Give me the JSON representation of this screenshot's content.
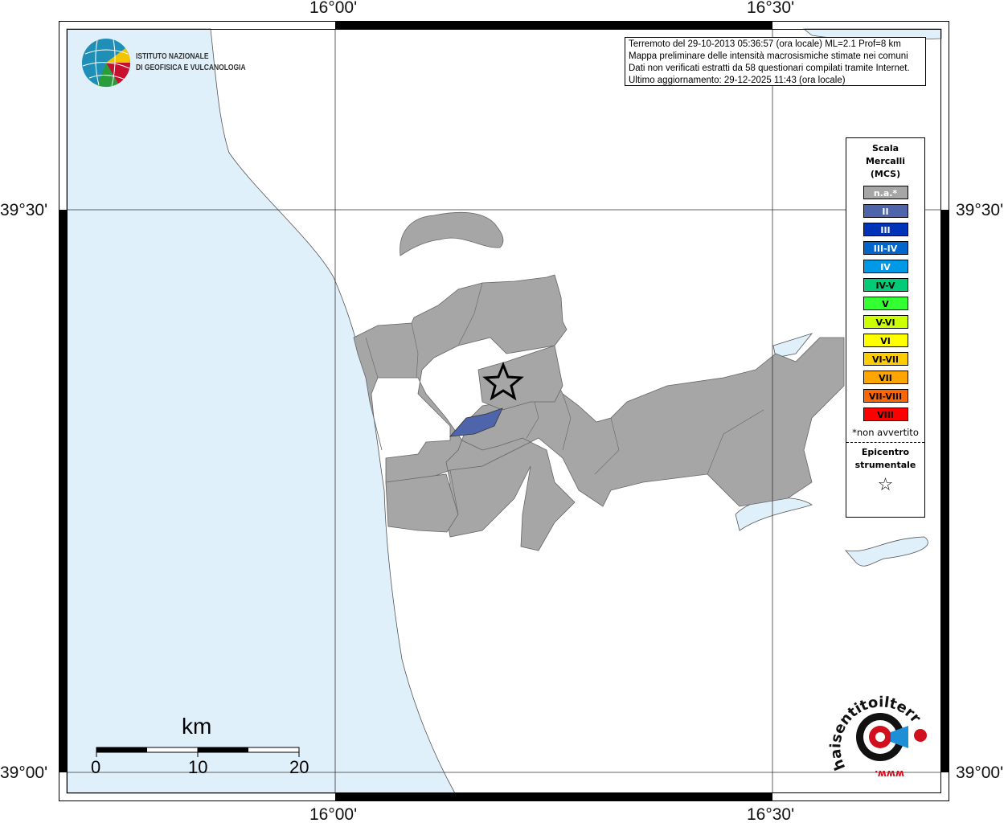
{
  "info": {
    "line1": "Terremoto del 29-10-2013 05:36:57 (ora locale) ML=2.1 Prof=8 km",
    "line2": "Mappa preliminare delle intensità macrosismiche stimate nei comuni",
    "line3": "Dati non verificati estratti da 58 questionari compilati tramite Internet.",
    "line4": "Ultimo aggiornamento: 29-12-2025 11:43 (ora locale)"
  },
  "axes": {
    "lon_left": "16°00'",
    "lon_right": "16°30'",
    "lat_top": "39°30'",
    "lat_bottom": "39°00'"
  },
  "logo": {
    "line1": "ISTITUTO NAZIONALE",
    "line2": "DI GEOFISICA E VULCANOLOGIA"
  },
  "legend": {
    "title1": "Scala",
    "title2": "Mercalli",
    "title3": "(MCS)",
    "items": [
      {
        "label": "n.a.*",
        "color": "#a6a6a6",
        "text": "#fff"
      },
      {
        "label": "II",
        "color": "#4f65ab",
        "text": "#fff"
      },
      {
        "label": "III",
        "color": "#0033b8",
        "text": "#fff"
      },
      {
        "label": "III-IV",
        "color": "#0066cc",
        "text": "#fff"
      },
      {
        "label": "IV",
        "color": "#0099e6",
        "text": "#fff"
      },
      {
        "label": "IV-V",
        "color": "#00cc77",
        "text": "#000"
      },
      {
        "label": "V",
        "color": "#33ff33",
        "text": "#000"
      },
      {
        "label": "V-VI",
        "color": "#ccff00",
        "text": "#000"
      },
      {
        "label": "VI",
        "color": "#ffff00",
        "text": "#000"
      },
      {
        "label": "VI-VII",
        "color": "#ffcc00",
        "text": "#000"
      },
      {
        "label": "VII",
        "color": "#ffa500",
        "text": "#000"
      },
      {
        "label": "VII-VIII",
        "color": "#ff6600",
        "text": "#000"
      },
      {
        "label": "VIII",
        "color": "#ff0000",
        "text": "#000"
      }
    ],
    "note": "*non avvertito",
    "epi1": "Epicentro",
    "epi2": "strumentale",
    "star": "☆"
  },
  "scale": {
    "unit": "km",
    "l0": "0",
    "l1": "10",
    "l2": "20"
  },
  "hsi": {
    "text": "haisentitoilterremoto.it",
    "www": "www."
  }
}
